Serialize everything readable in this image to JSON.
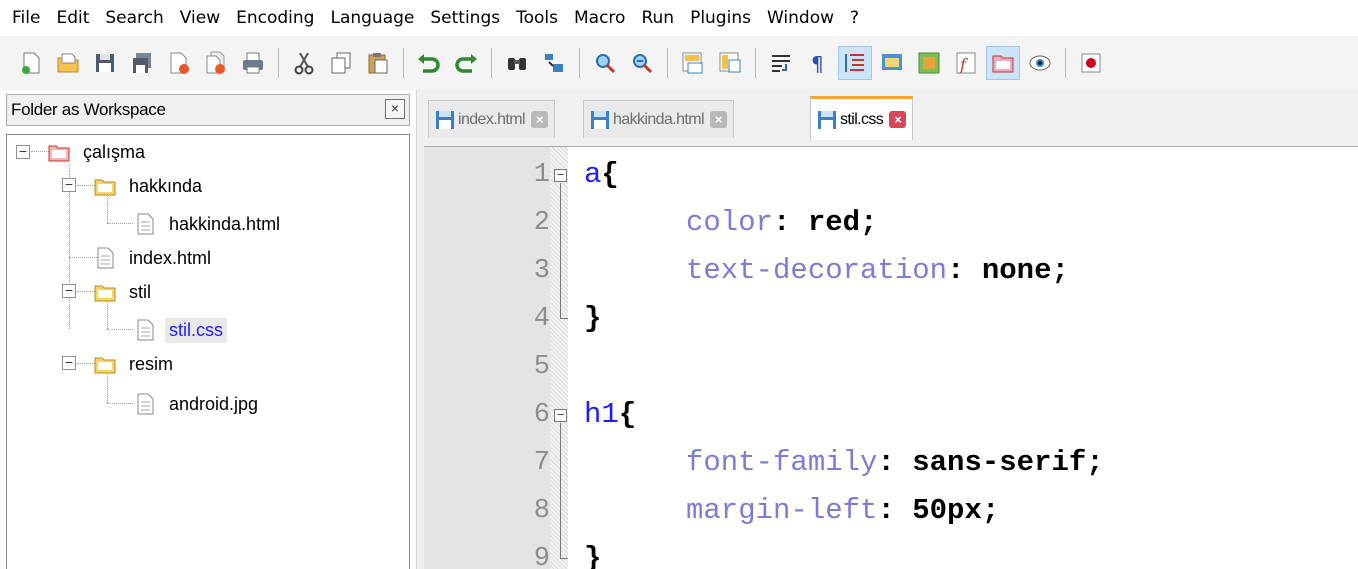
{
  "menu": [
    "File",
    "Edit",
    "Search",
    "View",
    "Encoding",
    "Language",
    "Settings",
    "Tools",
    "Macro",
    "Run",
    "Plugins",
    "Window",
    "?"
  ],
  "toolbar": {
    "icons": [
      "new-file-icon",
      "open-file-icon",
      "save-icon",
      "save-all-icon",
      "close-icon",
      "close-all-icon",
      "print-icon",
      "cut-icon",
      "copy-icon",
      "paste-icon",
      "undo-icon",
      "redo-icon",
      "find-icon",
      "replace-icon",
      "zoom-in-icon",
      "zoom-out-icon",
      "sync-vertical-icon",
      "sync-horizontal-icon",
      "word-wrap-icon",
      "show-all-characters-icon",
      "indent-guide-icon",
      "user-defined-language-icon",
      "document-map-icon",
      "function-list-icon",
      "folder-as-workspace-icon",
      "monitoring-icon",
      "record-macro-icon"
    ],
    "active": [
      "indent-guide-icon",
      "folder-as-workspace-icon"
    ]
  },
  "panel": {
    "title": "Folder as Workspace",
    "close_label": "×",
    "tree": {
      "root": "çalışma",
      "hakkinda_folder": "hakkında",
      "hakkinda_file": "hakkinda.html",
      "index_file": "index.html",
      "stil_folder": "stil",
      "stil_file": "stil.css",
      "resim_folder": "resim",
      "resim_file": "android.jpg"
    },
    "selected": "stil.css"
  },
  "tabs": [
    {
      "label": "index.html",
      "active": false
    },
    {
      "label": "hakkinda.html",
      "active": false
    },
    {
      "label": "stil.css",
      "active": true
    }
  ],
  "tab_close_glyph": "×",
  "editor": {
    "line_numbers": [
      "1",
      "2",
      "3",
      "4",
      "5",
      "6",
      "7",
      "8",
      "9"
    ],
    "lines": {
      "l1_selector": "a",
      "l1_brace": "{",
      "l2_prop": "color",
      "l2_colon": ":",
      "l2_value": "red;",
      "l3_prop": "text-decoration",
      "l3_colon": ":",
      "l3_value": "none;",
      "l4_brace": "}",
      "l6_selector": "h1",
      "l6_brace": "{",
      "l7_prop": "font-family",
      "l7_colon": ":",
      "l7_value": "sans-serif;",
      "l8_prop": "margin-left",
      "l8_colon": ":",
      "l8_value": "50px;",
      "l9_brace": "}"
    },
    "fold_glyph": "−"
  },
  "colors": {
    "selector": "#1c1cff",
    "property": "#7c7cd6",
    "active_tab_accent": "#f9a23b",
    "active_tab_close": "#d9475c"
  }
}
